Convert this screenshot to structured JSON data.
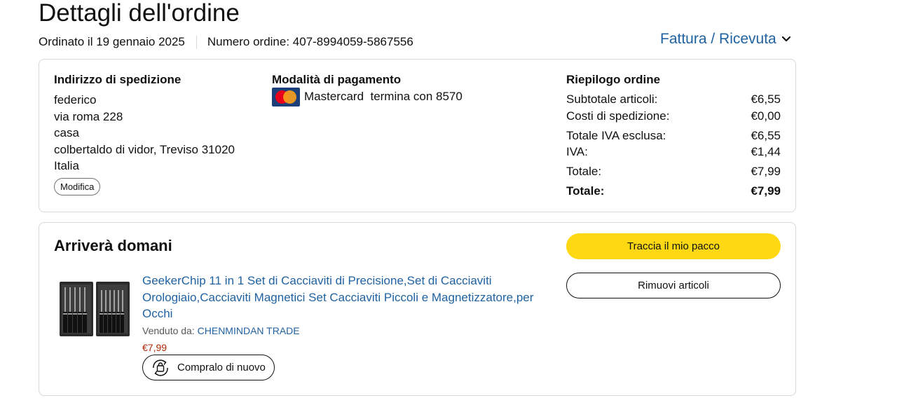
{
  "header": {
    "title": "Dettagli dell'ordine",
    "ordered_on": "Ordinato il 19 gennaio 2025",
    "order_number": "Numero ordine: 407-8994059-5867556",
    "invoice_label": "Fattura / Ricevuta",
    "invoice_icon": "chevron-down-icon"
  },
  "shipping": {
    "title": "Indirizzo di spedizione",
    "lines": [
      "federico",
      "via roma 228",
      "casa",
      "colbertaldo di vidor, Treviso 31020",
      "Italia"
    ],
    "edit_label": "Modifica"
  },
  "payment": {
    "title": "Modalità di pagamento",
    "card_icon": "mastercard-icon",
    "card_text": "Mastercard  termina con 8570"
  },
  "summary": {
    "title": "Riepilogo ordine",
    "rows": [
      {
        "label": "Subtotale articoli:",
        "value": "€6,55"
      },
      {
        "label": "Costi di spedizione:",
        "value": "€0,00"
      },
      {
        "label": "Totale IVA esclusa:",
        "value": "€6,55"
      },
      {
        "label": "IVA:",
        "value": "€1,44"
      },
      {
        "label": "Totale:",
        "value": "€7,99"
      },
      {
        "label": "Totale:",
        "value": "€7,99"
      }
    ]
  },
  "shipment": {
    "status": "Arriverà domani",
    "track_label": "Traccia il mio pacco",
    "remove_label": "Rimuovi articoli",
    "item": {
      "title": "GeekerChip 11 in 1 Set di Cacciaviti di Precisione,Set di Cacciaviti Orologiaio,Cacciaviti Magnetici Set Cacciaviti Piccoli e Magnetizzatore,per Occhi",
      "sold_by_label": "Venduto da:",
      "seller": "CHENMINDAN TRADE",
      "price": "€7,99",
      "buy_again_label": "Compralo di nuovo",
      "buy_again_icon": "buy-again-icon"
    }
  },
  "colors": {
    "link": "#2162a1",
    "primary_button": "#ffd814",
    "price": "#b12704",
    "border": "#d5d9d9"
  }
}
